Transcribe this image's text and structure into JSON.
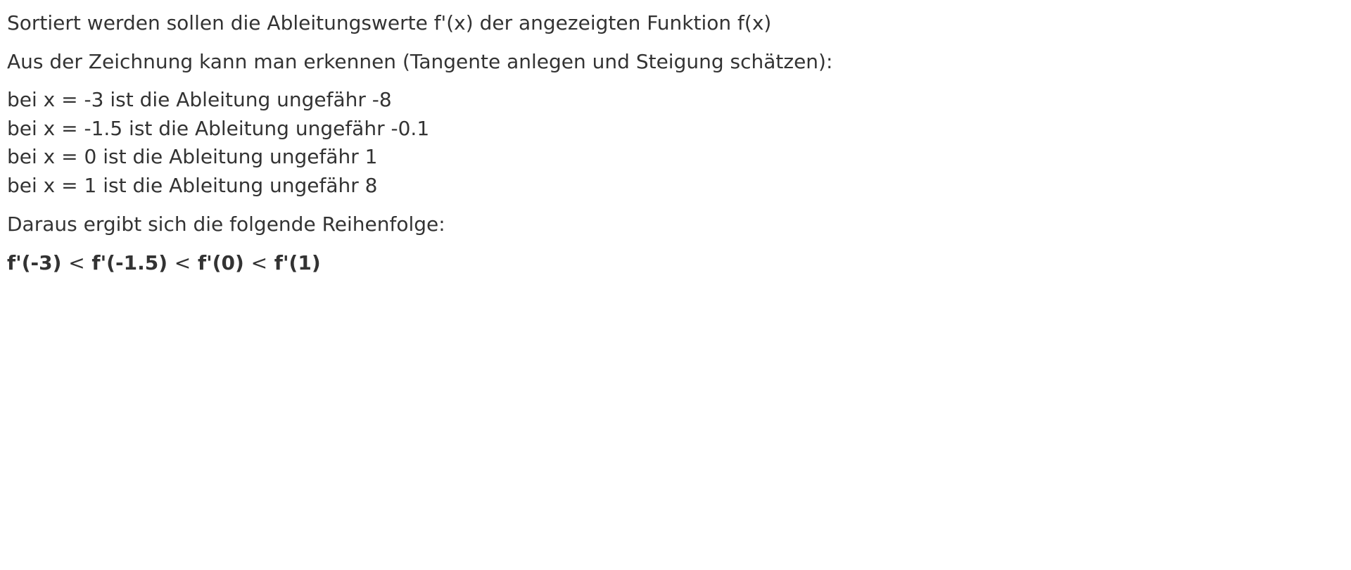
{
  "intro": "Sortiert werden sollen die Ableitungswerte f'(x) der angezeigten Funktion f(x)",
  "explanation": "Aus der Zeichnung kann man erkennen (Tangente anlegen und Steigung schätzen):",
  "estimates": [
    "bei x = -3 ist die Ableitung ungefähr -8",
    "bei x = -1.5 ist die Ableitung ungefähr -0.1",
    "bei x = 0 ist die Ableitung ungefähr 1",
    "bei x = 1 ist die Ableitung ungefähr 8"
  ],
  "conclusion": "Daraus ergibt sich die folgende Reihenfolge:",
  "ordering": {
    "terms": [
      "f'(-3)",
      "f'(-1.5)",
      "f'(0)",
      "f'(1)"
    ],
    "separator": "<"
  }
}
